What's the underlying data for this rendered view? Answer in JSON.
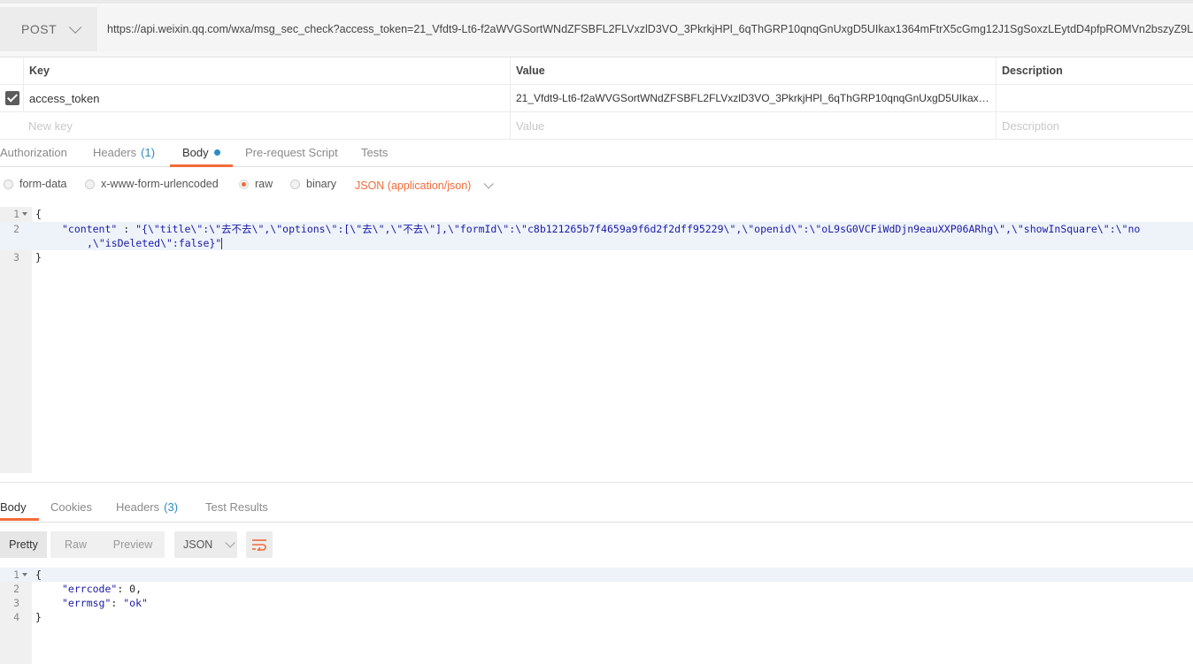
{
  "request": {
    "method": "POST",
    "url": "https://api.weixin.qq.com/wxa/msg_sec_check?access_token=21_Vfdt9-Lt6-f2aWVGSortWNdZFSBFL2FLVxzlD3VO_3PkrkjHPl_6qThGRP10qnqGnUxgD5UIkax1364mFtrX5cGmg12J1SgSoxzLEytdD4pfpROMVn2bszyZ9L5AdnVp"
  },
  "params": {
    "headers": {
      "key": "Key",
      "value": "Value",
      "description": "Description"
    },
    "rows": [
      {
        "key": "access_token",
        "value": "21_Vfdt9-Lt6-f2aWVGSortWNdZFSBFL2FLVxzlD3VO_3PkrkjHPl_6qThGRP10qnqGnUxgD5UIkax…",
        "checked": true
      }
    ],
    "placeholders": {
      "key": "New key",
      "value": "Value",
      "description": "Description"
    }
  },
  "request_tabs": {
    "authorization": "Authorization",
    "headers": "Headers",
    "headers_count": "(1)",
    "body": "Body",
    "prerequest": "Pre-request Script",
    "tests": "Tests"
  },
  "body_options": {
    "form_data": "form-data",
    "urlencoded": "x-www-form-urlencoded",
    "raw": "raw",
    "binary": "binary",
    "content_type": "JSON (application/json)"
  },
  "request_body": {
    "line_numbers": [
      "1",
      "2",
      "",
      "3"
    ],
    "line1": "{",
    "line2_key": "\"content\"",
    "line2_sep": " : ",
    "line2_value": "\"{\\\"title\\\":\\\"去不去\\\",\\\"options\\\":[\\\"去\\\",\\\"不去\\\"],\\\"formId\\\":\\\"c8b121265b7f4659a9f6d2f2dff95229\\\",\\\"openid\\\":\\\"oL9sG0VCFiWdDjn9eauXXP06ARhg\\\",\\\"showInSquare\\\":\\\"no",
    "line2_cont": ",\\\"isDeleted\\\":false}\"",
    "line3": "}"
  },
  "response_tabs": {
    "body": "Body",
    "cookies": "Cookies",
    "headers": "Headers",
    "headers_count": "(3)",
    "test_results": "Test Results"
  },
  "response_toolbar": {
    "pretty": "Pretty",
    "raw": "Raw",
    "preview": "Preview",
    "format": "JSON"
  },
  "response_body": {
    "line_numbers": [
      "1",
      "2",
      "3",
      "4"
    ],
    "line1": "{",
    "errcode_key": "\"errcode\"",
    "errcode_val": "0",
    "errmsg_key": "\"errmsg\"",
    "errmsg_val": "\"ok\"",
    "line4": "}"
  },
  "colors": {
    "accent": "#f26b3a",
    "link_blue": "#2d8ac7",
    "string_blue": "#1a1aa6"
  }
}
